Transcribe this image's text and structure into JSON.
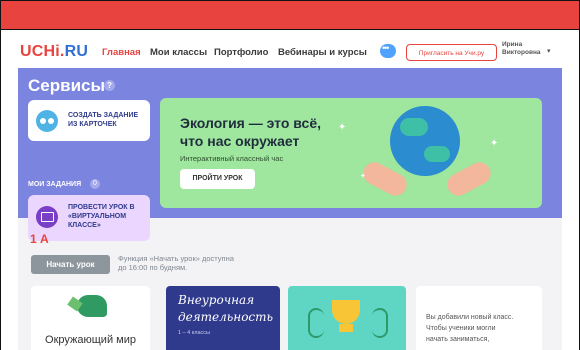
{
  "header": {
    "logo_part1": "UCHi.",
    "logo_part2": "RU",
    "nav": [
      "Главная",
      "Мои классы",
      "Портфолио",
      "Вебинары и курсы"
    ],
    "invite_label": "Пригласить на Учи.ру",
    "user_first": "Ирина",
    "user_last": "Викторовна"
  },
  "services": {
    "title": "Сервисы",
    "help": "?",
    "create_task": "СОЗДАТЬ ЗАДАНИЕ ИЗ КАРТОЧЕК",
    "my_tasks": "МОИ ЗАДАНИЯ",
    "my_tasks_count": "0",
    "virtual_lesson": "ПРОВЕСТИ УРОК В «ВИРТУАЛЬНОМ КЛАССЕ»"
  },
  "promo": {
    "title_line1": "Экология — это всё,",
    "title_line2": "что нас окружает",
    "subtitle": "Интерактивный классный час",
    "button": "ПРОЙТИ УРОК"
  },
  "class_section": {
    "class_name": "1 А",
    "start_button": "Начать урок",
    "note_line1": "Функция «Начать урок» доступна",
    "note_line2": "до 16:00 по будням."
  },
  "tiles": {
    "world": "Окружающий мир",
    "extra_line1": "Внеурочная",
    "extra_line2": "деятельность",
    "extra_sub": "1 – 4 классы",
    "note_line1": "Вы добавили новый класс.",
    "note_line2": "Чтобы ученики могли",
    "note_line3": "начать заниматься,"
  },
  "colors": {
    "brand_red": "#e8433f",
    "brand_blue": "#2f6fd6",
    "services_bg": "#7b84df",
    "promo_bg": "#9fe69e"
  }
}
